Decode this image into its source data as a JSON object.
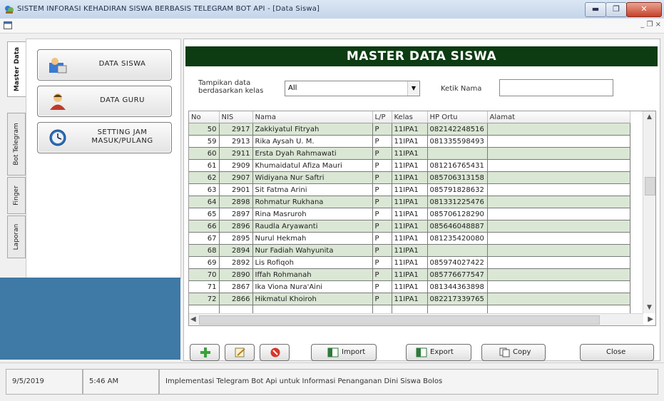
{
  "window": {
    "title": "SISTEM INFORASI KEHADIRAN SISWA BERBASIS TELEGRAM BOT API - [Data Siswa]",
    "mdi_controls": "_ ❐ ×"
  },
  "vertical_tabs": [
    "Master Data",
    "Bot Telegram",
    "Finger",
    "Laporan"
  ],
  "nav": {
    "data_siswa": "DATA SISWA",
    "data_guru": "DATA GURU",
    "setting_jam_line1": "SETTING JAM",
    "setting_jam_line2": "MASUK/PULANG"
  },
  "main": {
    "header": "MASTER DATA SISWA",
    "filter_label_line1": "Tampikan data",
    "filter_label_line2": "berdasarkan kelas",
    "filter_value": "All",
    "search_label": "Ketik Nama",
    "search_value": ""
  },
  "table": {
    "columns": [
      "No",
      "NIS",
      "Nama",
      "L/P",
      "Kelas",
      "HP Ortu",
      "Alamat"
    ],
    "rows": [
      {
        "no": "50",
        "nis": "2917",
        "nama": "Zakkiyatul Fitryah",
        "lp": "P",
        "kelas": "11IPA1",
        "hp": "082142248516",
        "alamat": ""
      },
      {
        "no": "59",
        "nis": "2913",
        "nama": "Rika Aysah U. M.",
        "lp": "P",
        "kelas": "11IPA1",
        "hp": "081335598493",
        "alamat": ""
      },
      {
        "no": "60",
        "nis": "2911",
        "nama": "Ersta Dyah Rahmawati",
        "lp": "P",
        "kelas": "11IPA1",
        "hp": "",
        "alamat": ""
      },
      {
        "no": "61",
        "nis": "2909",
        "nama": "Khumaidatul Afiza Mauri",
        "lp": "P",
        "kelas": "11IPA1",
        "hp": "081216765431",
        "alamat": ""
      },
      {
        "no": "62",
        "nis": "2907",
        "nama": "Widiyana Nur Saftri",
        "lp": "P",
        "kelas": "11IPA1",
        "hp": "085706313158",
        "alamat": ""
      },
      {
        "no": "63",
        "nis": "2901",
        "nama": "Sit Fatma Arini",
        "lp": "P",
        "kelas": "11IPA1",
        "hp": "085791828632",
        "alamat": ""
      },
      {
        "no": "64",
        "nis": "2898",
        "nama": "Rohmatur Rukhana",
        "lp": "P",
        "kelas": "11IPA1",
        "hp": "081331225476",
        "alamat": ""
      },
      {
        "no": "65",
        "nis": "2897",
        "nama": "Rina Masruroh",
        "lp": "P",
        "kelas": "11IPA1",
        "hp": "085706128290",
        "alamat": ""
      },
      {
        "no": "66",
        "nis": "2896",
        "nama": "Raudla Aryawanti",
        "lp": "P",
        "kelas": "11IPA1",
        "hp": "085646048887",
        "alamat": ""
      },
      {
        "no": "67",
        "nis": "2895",
        "nama": "Nurul Hekmah",
        "lp": "P",
        "kelas": "11IPA1",
        "hp": "081235420080",
        "alamat": ""
      },
      {
        "no": "68",
        "nis": "2894",
        "nama": "Nur Fadiah Wahyunita",
        "lp": "P",
        "kelas": "11IPA1",
        "hp": "",
        "alamat": ""
      },
      {
        "no": "69",
        "nis": "2892",
        "nama": "Lis Rofiqoh",
        "lp": "P",
        "kelas": "11IPA1",
        "hp": "085974027422",
        "alamat": ""
      },
      {
        "no": "70",
        "nis": "2890",
        "nama": "Iffah Rohmanah",
        "lp": "P",
        "kelas": "11IPA1",
        "hp": "085776677547",
        "alamat": ""
      },
      {
        "no": "71",
        "nis": "2867",
        "nama": "Ika Viona Nura'Aini",
        "lp": "P",
        "kelas": "11IPA1",
        "hp": "081344363898",
        "alamat": ""
      },
      {
        "no": "72",
        "nis": "2866",
        "nama": "Hikmatul Khoiroh",
        "lp": "P",
        "kelas": "11IPA1",
        "hp": "082217339765",
        "alamat": ""
      }
    ]
  },
  "toolbar": {
    "import": "Import",
    "export": "Export",
    "copy": "Copy",
    "close": "Close"
  },
  "status": {
    "date": "9/5/2019",
    "time": "5:46 AM",
    "message": "Implementasi Telegram Bot Api untuk Informasi Penanganan Dini Siswa Bolos"
  },
  "colors": {
    "header_bg": "#0d3b12",
    "row_alt": "#dbe7d5",
    "left_bottom": "#3f79a6"
  }
}
